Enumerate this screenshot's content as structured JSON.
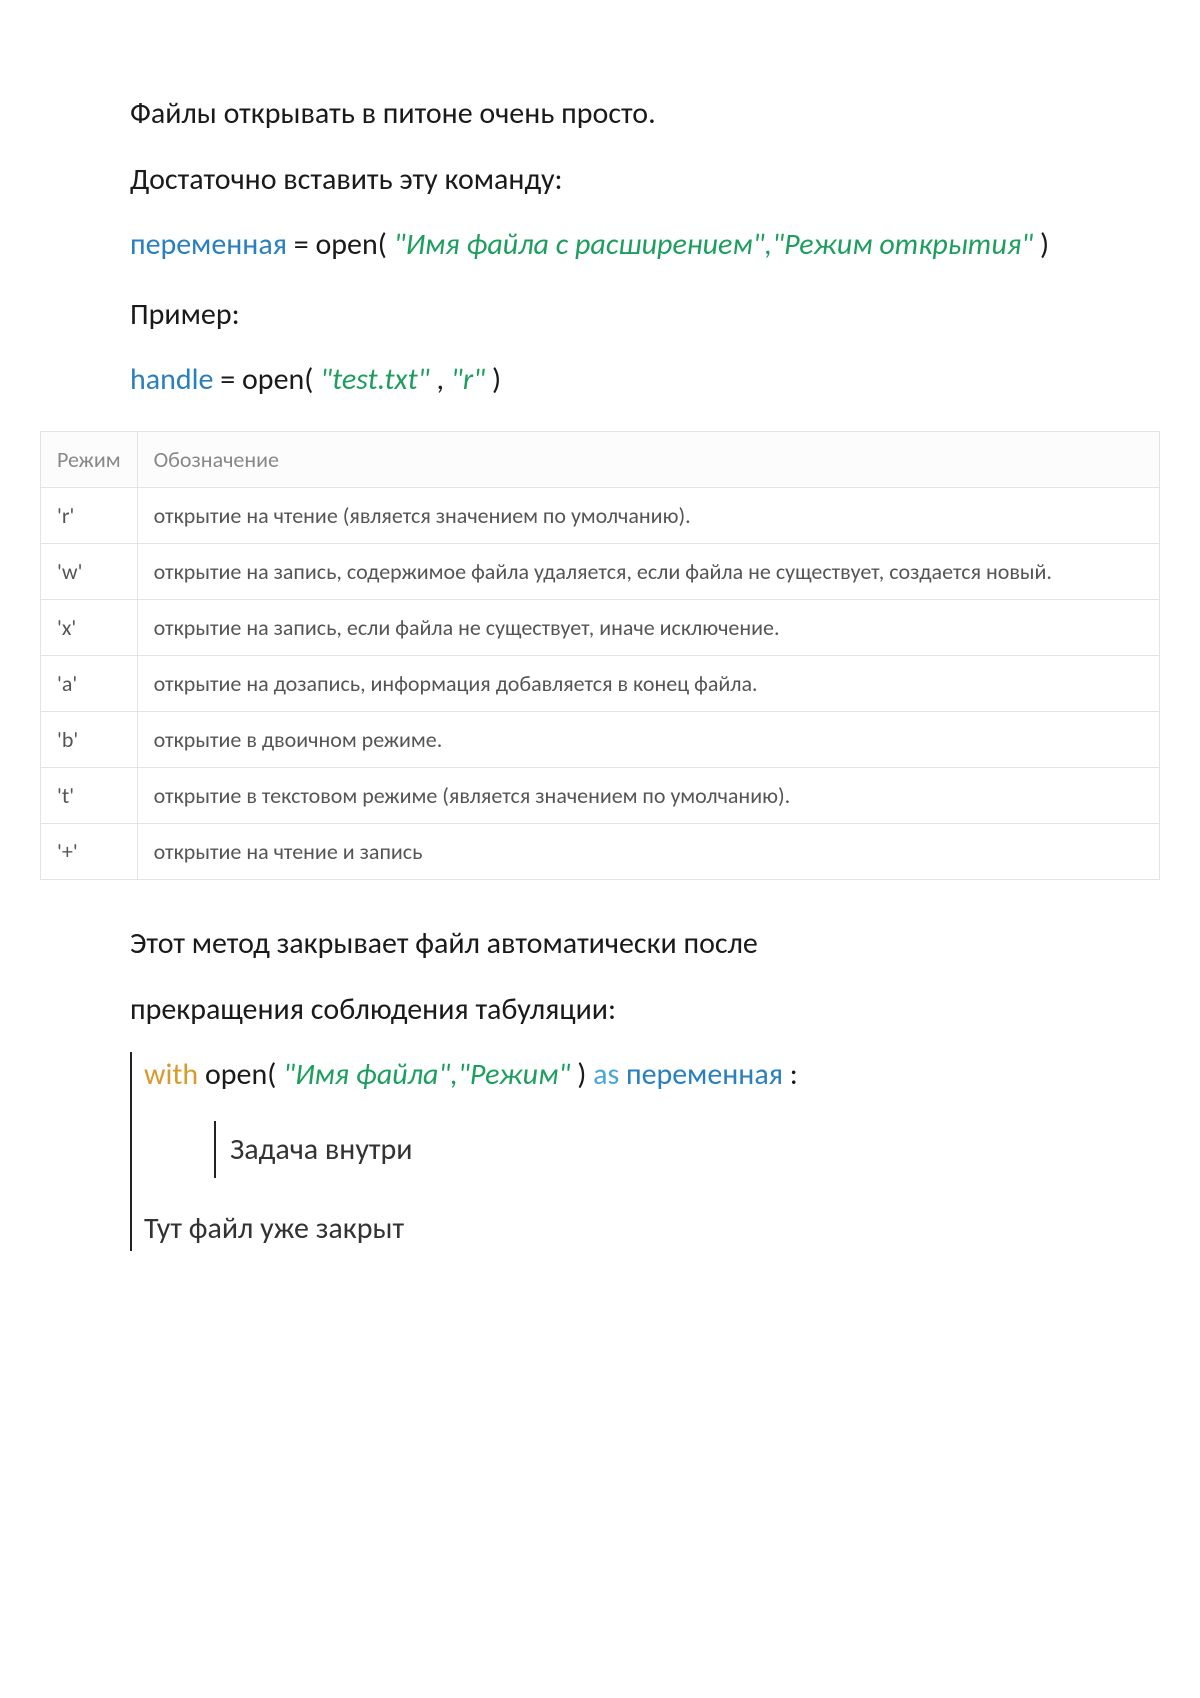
{
  "intro": {
    "line1": "Файлы открывать в питоне очень просто.",
    "line2": "Достаточно вставить эту команду:"
  },
  "code1": {
    "var": "переменная",
    "after_var": " = open(",
    "str": "\"Имя файла с расширением\",\"Режим открытия\"",
    "end": ")"
  },
  "example_label": "Пример:",
  "code2": {
    "var": "handle",
    "after_var": " = open(",
    "str1": "\"test.txt\"",
    "sep": ", ",
    "str2": "\"r\"",
    "end": ")"
  },
  "table": {
    "head_mode": "Режим",
    "head_desc": "Обозначение",
    "rows": [
      {
        "mode": "'r'",
        "desc": "открытие на чтение (является значением по умолчанию)."
      },
      {
        "mode": "'w'",
        "desc": "открытие на запись, содержимое файла удаляется, если файла не существует, создается новый."
      },
      {
        "mode": "'x'",
        "desc": "открытие на запись, если файла не существует, иначе исключение."
      },
      {
        "mode": "'a'",
        "desc": "открытие на дозапись, информация добавляется в конец файла."
      },
      {
        "mode": "'b'",
        "desc": "открытие в двоичном режиме."
      },
      {
        "mode": "'t'",
        "desc": "открытие в текстовом режиме (является значением по умолчанию)."
      },
      {
        "mode": "'+'",
        "desc": "открытие на чтение и запись"
      }
    ]
  },
  "paragraph2": {
    "line1": "Этот метод закрывает файл автоматически  после",
    "line2": "прекращения соблюдения табуляции:"
  },
  "with": {
    "with_kw": "with",
    "open_pre": " open(",
    "str": "\"Имя файла\",\"Режим\"",
    "open_post": ") ",
    "as_kw": "as",
    "var": " переменная",
    "colon": ":",
    "inner": "Задача внутри",
    "after": "Тут файл уже закрыт"
  }
}
